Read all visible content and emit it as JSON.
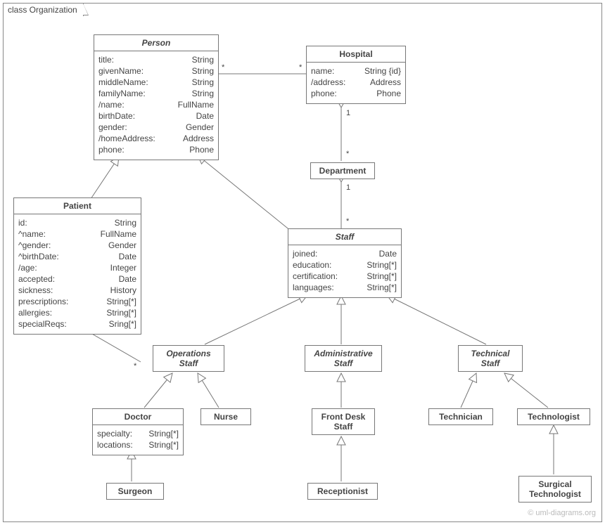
{
  "frame": {
    "label": "class Organization"
  },
  "watermark": "© uml-diagrams.org",
  "classes": {
    "person": {
      "name": "Person",
      "attrs": [
        [
          "title:",
          "String"
        ],
        [
          "givenName:",
          "String"
        ],
        [
          "middleName:",
          "String"
        ],
        [
          "familyName:",
          "String"
        ],
        [
          "/name:",
          "FullName"
        ],
        [
          "birthDate:",
          "Date"
        ],
        [
          "gender:",
          "Gender"
        ],
        [
          "/homeAddress:",
          "Address"
        ],
        [
          "phone:",
          "Phone"
        ]
      ]
    },
    "hospital": {
      "name": "Hospital",
      "attrs": [
        [
          "name:",
          "String {id}"
        ],
        [
          "/address:",
          "Address"
        ],
        [
          "phone:",
          "Phone"
        ]
      ]
    },
    "department": {
      "name": "Department"
    },
    "patient": {
      "name": "Patient",
      "attrs": [
        [
          "id:",
          "String"
        ],
        [
          "^name:",
          "FullName"
        ],
        [
          "^gender:",
          "Gender"
        ],
        [
          "^birthDate:",
          "Date"
        ],
        [
          "/age:",
          "Integer"
        ],
        [
          "accepted:",
          "Date"
        ],
        [
          "sickness:",
          "History"
        ],
        [
          "prescriptions:",
          "String[*]"
        ],
        [
          "allergies:",
          "String[*]"
        ],
        [
          "specialReqs:",
          "Sring[*]"
        ]
      ]
    },
    "staff": {
      "name": "Staff",
      "attrs": [
        [
          "joined:",
          "Date"
        ],
        [
          "education:",
          "String[*]"
        ],
        [
          "certification:",
          "String[*]"
        ],
        [
          "languages:",
          "String[*]"
        ]
      ]
    },
    "opsStaff": {
      "name": "Operations\nStaff"
    },
    "adminStaff": {
      "name": "Administrative\nStaff"
    },
    "techStaff": {
      "name": "Technical\nStaff"
    },
    "doctor": {
      "name": "Doctor",
      "attrs": [
        [
          "specialty:",
          "String[*]"
        ],
        [
          "locations:",
          "String[*]"
        ]
      ]
    },
    "nurse": {
      "name": "Nurse"
    },
    "frontDesk": {
      "name": "Front Desk\nStaff"
    },
    "technician": {
      "name": "Technician"
    },
    "technologist": {
      "name": "Technologist"
    },
    "surgeon": {
      "name": "Surgeon"
    },
    "receptionist": {
      "name": "Receptionist"
    },
    "surgTech": {
      "name": "Surgical\nTechnologist"
    }
  },
  "mult": {
    "personHospL": "*",
    "personHospR": "*",
    "hospDeptTop": "1",
    "hospDeptBot": "*",
    "deptStaffTop": "1",
    "deptStaffBot": "*",
    "patientDocL": "*",
    "patientDocR": "*"
  }
}
